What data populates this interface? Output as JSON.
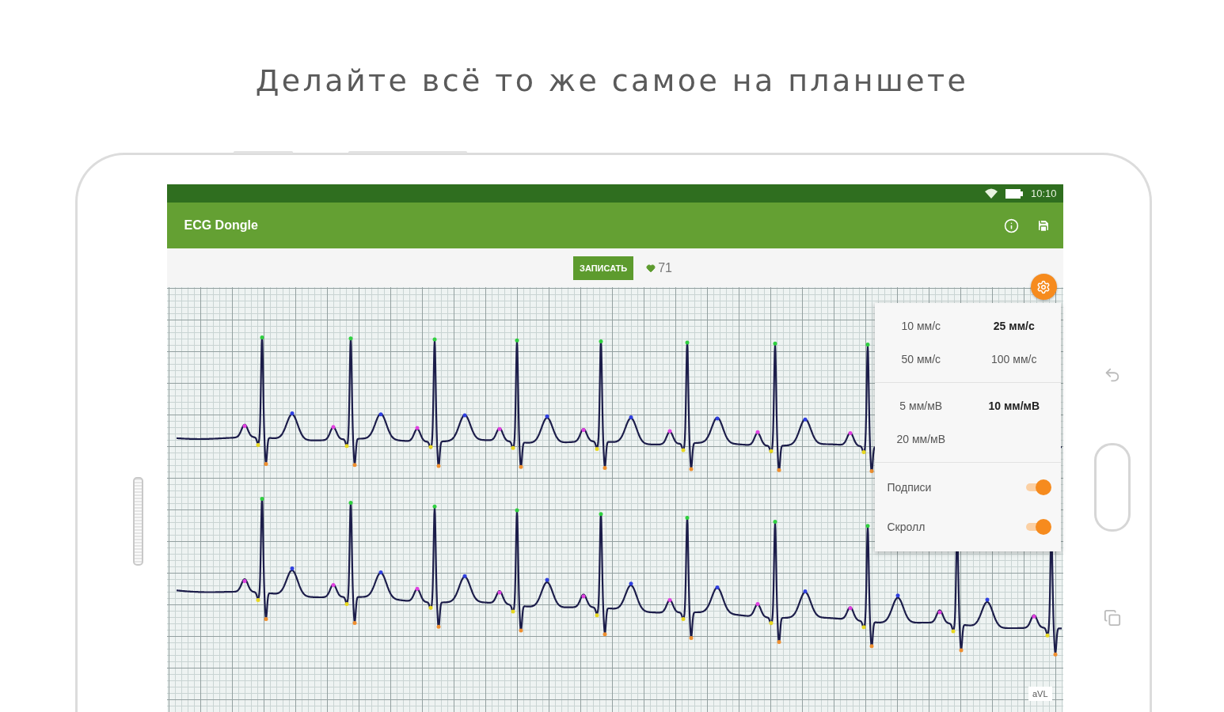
{
  "headline": "Делайте всё то же самое на планшете",
  "status_bar": {
    "time": "10:10"
  },
  "app_bar": {
    "title": "ECG Dongle"
  },
  "toolbar": {
    "record_button": "ЗАПИСАТЬ",
    "heart_rate": "71"
  },
  "ecg": {
    "lead_label": "aVL"
  },
  "settings": {
    "speed_options": [
      {
        "label": "10 мм/с",
        "selected": false
      },
      {
        "label": "25 мм/с",
        "selected": true
      },
      {
        "label": "50 мм/с",
        "selected": false
      },
      {
        "label": "100 мм/с",
        "selected": false
      }
    ],
    "gain_options": [
      {
        "label": "5 мм/мВ",
        "selected": false
      },
      {
        "label": "10 мм/мВ",
        "selected": true
      },
      {
        "label": "20 мм/мВ",
        "selected": false
      }
    ],
    "toggles": [
      {
        "label": "Подписи",
        "on": true
      },
      {
        "label": "Скролл",
        "on": true
      }
    ]
  }
}
